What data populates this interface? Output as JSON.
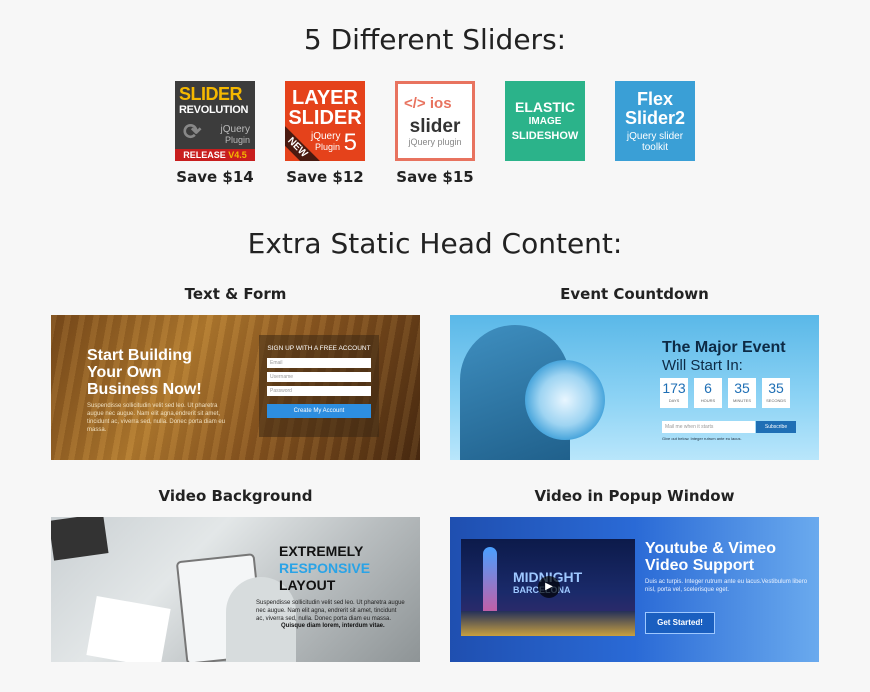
{
  "headings": {
    "sliders": "5 Different Sliders:",
    "static": "Extra Static Head Content:"
  },
  "sliders": [
    {
      "l1": "SLIDER",
      "l2": "REVOLUTION",
      "l3": "jQuery",
      "l4": "Plugin",
      "release": "RELEASE",
      "ver": "V4.5",
      "save": "Save $14"
    },
    {
      "l1": "LAYER",
      "l2": "SLIDER",
      "l3": "jQuery",
      "l4": "Plugin",
      "num": "5",
      "ribbon": "NEW",
      "save": "Save $12"
    },
    {
      "code": "</>",
      "l1": "ios",
      "l2": "slider",
      "l3": "jQuery plugin",
      "save": "Save $15"
    },
    {
      "l1": "ELASTIC",
      "l2": "IMAGE",
      "l3": "SLIDESHOW",
      "save": ""
    },
    {
      "l1": "Flex",
      "l2": "Slider2",
      "l3": "jQuery slider",
      "l4": "toolkit",
      "save": ""
    }
  ],
  "panels": {
    "text_form": {
      "label": "Text & Form",
      "headline": [
        "Start Building",
        "Your Own",
        "Business Now!"
      ],
      "body": "Suspendisse sollicitudin velit sed leo. Ut pharetra augue nec augue. Nam elit agna,endrerit sit amet, tincidunt ac, viverra sed, nulla. Donec porta diam eu massa.",
      "form_title": "SIGN UP WITH A FREE ACCOUNT",
      "fields": [
        "Email",
        "Username",
        "Password"
      ],
      "button": "Create My Account"
    },
    "countdown": {
      "label": "Event Countdown",
      "title": "The Major Event",
      "subtitle": "Will Start In:",
      "units": [
        {
          "value": "173",
          "unit": "DAYS"
        },
        {
          "value": "6",
          "unit": "HOURS"
        },
        {
          "value": "35",
          "unit": "MINUTES"
        },
        {
          "value": "35",
          "unit": "SECONDS"
        }
      ],
      "placeholder": "Mail me when it starts",
      "button": "Subscribe",
      "note": "Give out below. Integer rutrum ante eu lacus."
    },
    "video_bg": {
      "label": "Video Background",
      "line1": "EXTREMELY",
      "line2": "RESPONSIVE",
      "line3": "LAYOUT",
      "body": "Suspendisse sollicitudin velit sed leo. Ut pharetra augue nec augue. Nam elit agna, endrerit sit amet, tincidunt ac, viverra sed, nulla. Donec porta diam eu massa.",
      "bold": "Quisque diam lorem, interdum vitae."
    },
    "video_popup": {
      "label": "Video in Popup Window",
      "title1": "Youtube & Vimeo",
      "title2": "Video Support",
      "body": "Duis ac turpis. Integer rutrum ante eu lacus.Vestibulum libero nisl, porta vel, scelerisque eget.",
      "button": "Get Started!",
      "video_text1": "MIDNIGHT",
      "video_text2": "BARCELONA"
    }
  },
  "colors": {
    "rev_bg": "#3c3c3c",
    "rev_yellow": "#f5b800",
    "rev_red": "#c81e1e",
    "layer_bg": "#e5421b",
    "ios_border": "#e8735f",
    "elastic_bg": "#2bb38a",
    "flex_bg": "#3a9fd6",
    "form_button": "#2d8ee0",
    "responsive_blue": "#2aa3e6"
  }
}
